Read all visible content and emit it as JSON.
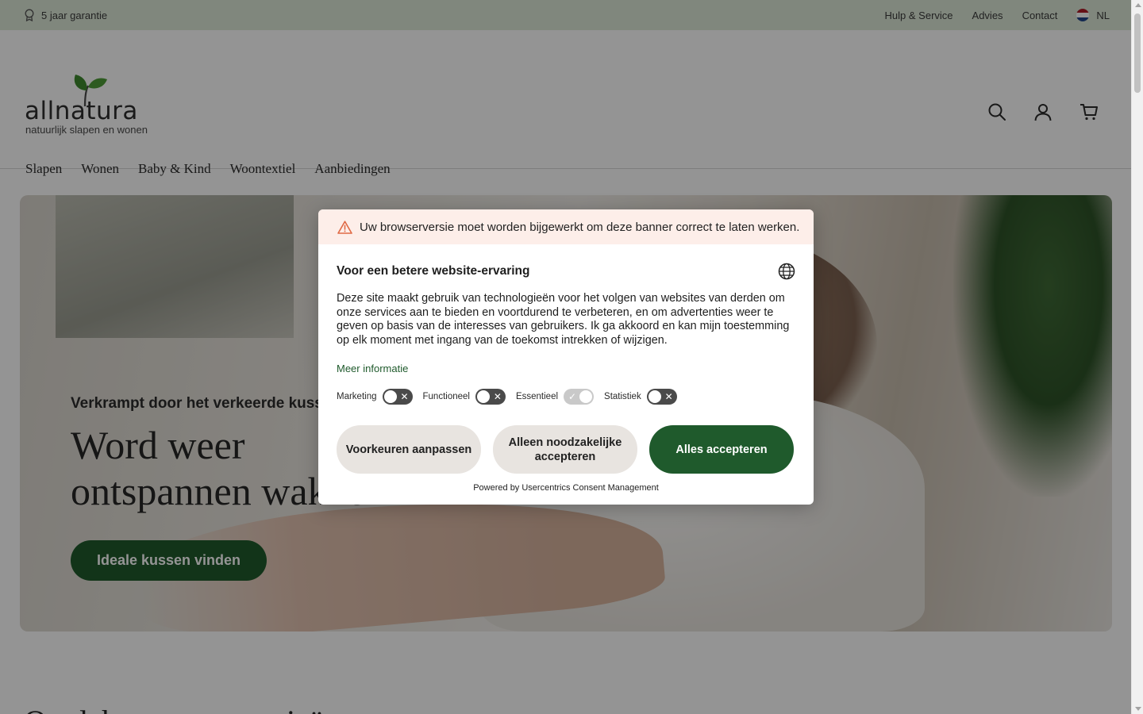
{
  "topbar": {
    "guarantee": "5 jaar garantie",
    "links": [
      "Hulp & Service",
      "Advies",
      "Contact"
    ],
    "language": "NL"
  },
  "logo": {
    "name": "allnatura",
    "tagline": "natuurlijk slapen en wonen"
  },
  "nav": [
    "Slapen",
    "Wonen",
    "Baby & Kind",
    "Woontextiel",
    "Aanbiedingen"
  ],
  "hero": {
    "eyebrow": "Verkrampt door het verkeerde kussen?",
    "title_line1": "Word weer",
    "title_line2": "ontspannen wakker",
    "button": "Ideale kussen vinden"
  },
  "section_title": "Ontdek onze categorieën",
  "consent": {
    "warning": "Uw browserversie moet worden bijgewerkt om deze banner correct te laten werken.",
    "title": "Voor een betere website-ervaring",
    "description": "Deze site maakt gebruik van technologieën voor het volgen van websites van derden om onze services aan te bieden en voortdurend te verbeteren, en om advertenties weer te geven op basis van de interesses van gebruikers. Ik ga akkoord en kan mijn toestemming op elk moment met ingang van de toekomst intrekken of wijzigen.",
    "more_info": "Meer informatie",
    "toggles": [
      {
        "label": "Marketing",
        "on": false
      },
      {
        "label": "Functioneel",
        "on": false
      },
      {
        "label": "Essentieel",
        "on": true
      },
      {
        "label": "Statistiek",
        "on": false
      }
    ],
    "buttons": {
      "preferences": "Voorkeuren aanpassen",
      "necessary": "Alleen noodzakelijke accepteren",
      "accept_all": "Alles accepteren"
    },
    "powered_by": "Powered by Usercentrics Consent Management"
  },
  "colors": {
    "brand_green": "#1f5a2c",
    "topbar_bg": "#dde8d8",
    "warning_bg": "#fdeee9",
    "warning_icon": "#e06a45"
  },
  "icons": [
    "award-icon",
    "flag-nl-icon",
    "search-icon",
    "account-icon",
    "cart-icon",
    "warning-icon",
    "globe-icon"
  ]
}
